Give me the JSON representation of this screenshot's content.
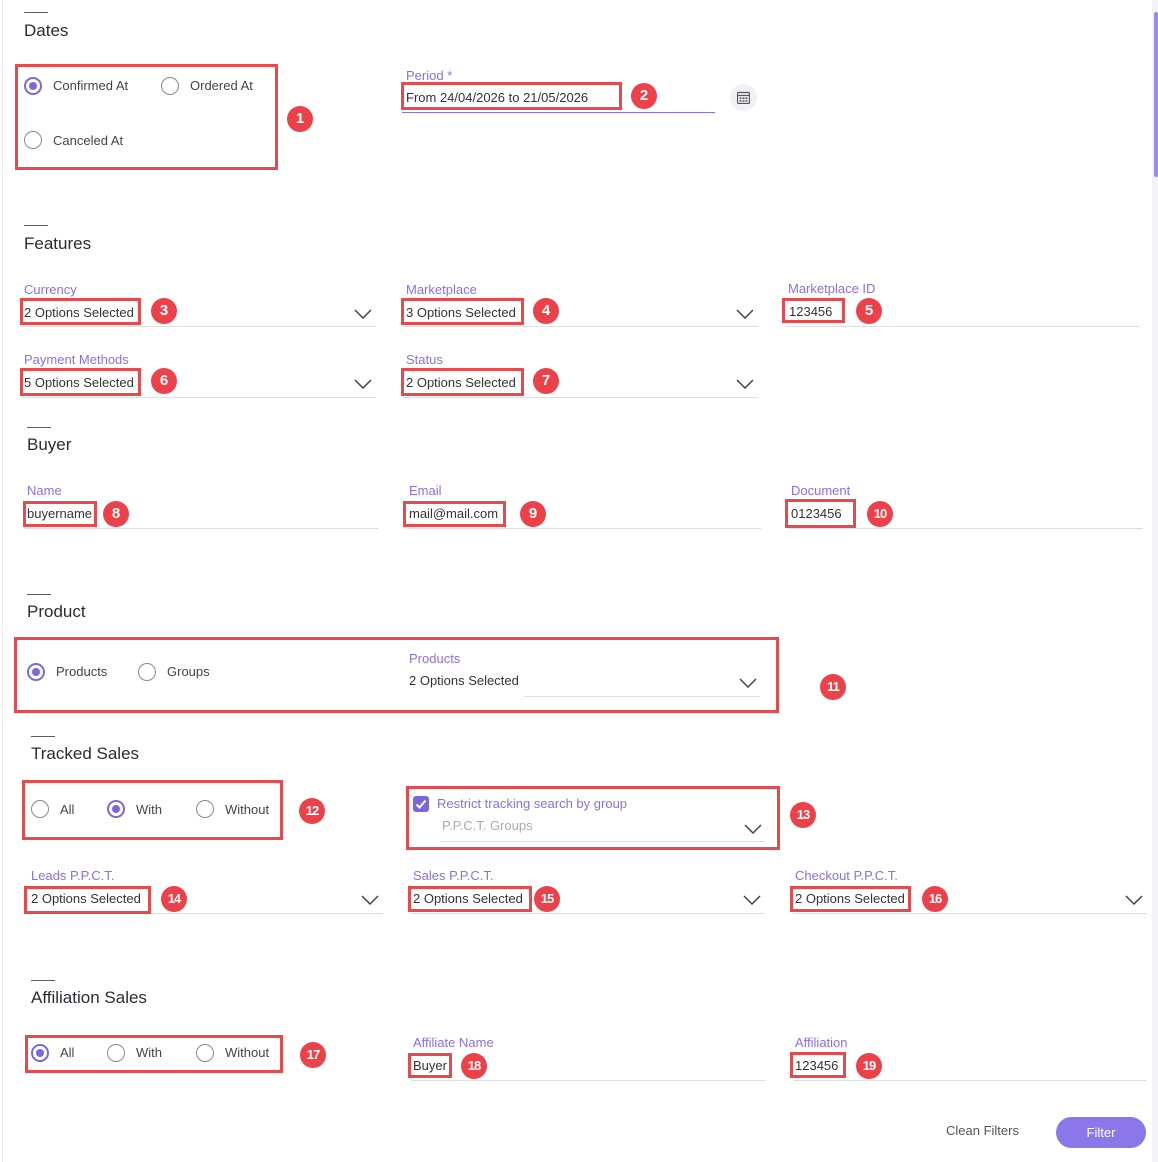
{
  "dates": {
    "title": "Dates",
    "radios": [
      "Confirmed At",
      "Ordered At",
      "Canceled At"
    ],
    "selected": "Confirmed At",
    "period_label": "Period *",
    "period_value": "From  24/04/2026  to  21/05/2026"
  },
  "features": {
    "title": "Features",
    "currency": {
      "label": "Currency",
      "value": "2 Options Selected"
    },
    "marketplace": {
      "label": "Marketplace",
      "value": "3 Options Selected"
    },
    "marketplace_id": {
      "label": "Marketplace ID",
      "value": "123456"
    },
    "payment_methods": {
      "label": "Payment Methods",
      "value": "5 Options Selected"
    },
    "status": {
      "label": "Status",
      "value": "2 Options Selected"
    }
  },
  "buyer": {
    "title": "Buyer",
    "name": {
      "label": "Name",
      "value": "buyername"
    },
    "email": {
      "label": "Email",
      "value": "mail@mail.com"
    },
    "document": {
      "label": "Document",
      "value": "0123456"
    }
  },
  "product": {
    "title": "Product",
    "radios": [
      "Products",
      "Groups"
    ],
    "selected": "Products",
    "products": {
      "label": "Products",
      "value": "2 Options Selected"
    }
  },
  "tracked_sales": {
    "title": "Tracked Sales",
    "radios": [
      "All",
      "With",
      "Without"
    ],
    "selected": "With",
    "restrict_label": "Restrict tracking search by group",
    "restrict_checked": true,
    "groups_placeholder": "P.P.C.T. Groups",
    "leads": {
      "label": "Leads P.P.C.T.",
      "value": "2 Options Selected"
    },
    "sales": {
      "label": "Sales P.P.C.T.",
      "value": "2 Options Selected"
    },
    "checkout": {
      "label": "Checkout P.P.C.T.",
      "value": "2 Options Selected"
    }
  },
  "affiliation_sales": {
    "title": "Affiliation Sales",
    "radios": [
      "All",
      "With",
      "Without"
    ],
    "selected": "All",
    "affiliate_name": {
      "label": "Affiliate Name",
      "value": "Buyer"
    },
    "affiliation": {
      "label": "Affiliation",
      "value": "123456"
    }
  },
  "actions": {
    "clean": "Clean Filters",
    "filter": "Filter"
  },
  "badges": [
    "1",
    "2",
    "3",
    "4",
    "5",
    "6",
    "7",
    "8",
    "9",
    "10",
    "11",
    "12",
    "13",
    "14",
    "15",
    "16",
    "17",
    "18",
    "19"
  ],
  "colors": {
    "accent": "#7c66e0",
    "highlight": "#e8494d",
    "badge": "#ec4148"
  }
}
